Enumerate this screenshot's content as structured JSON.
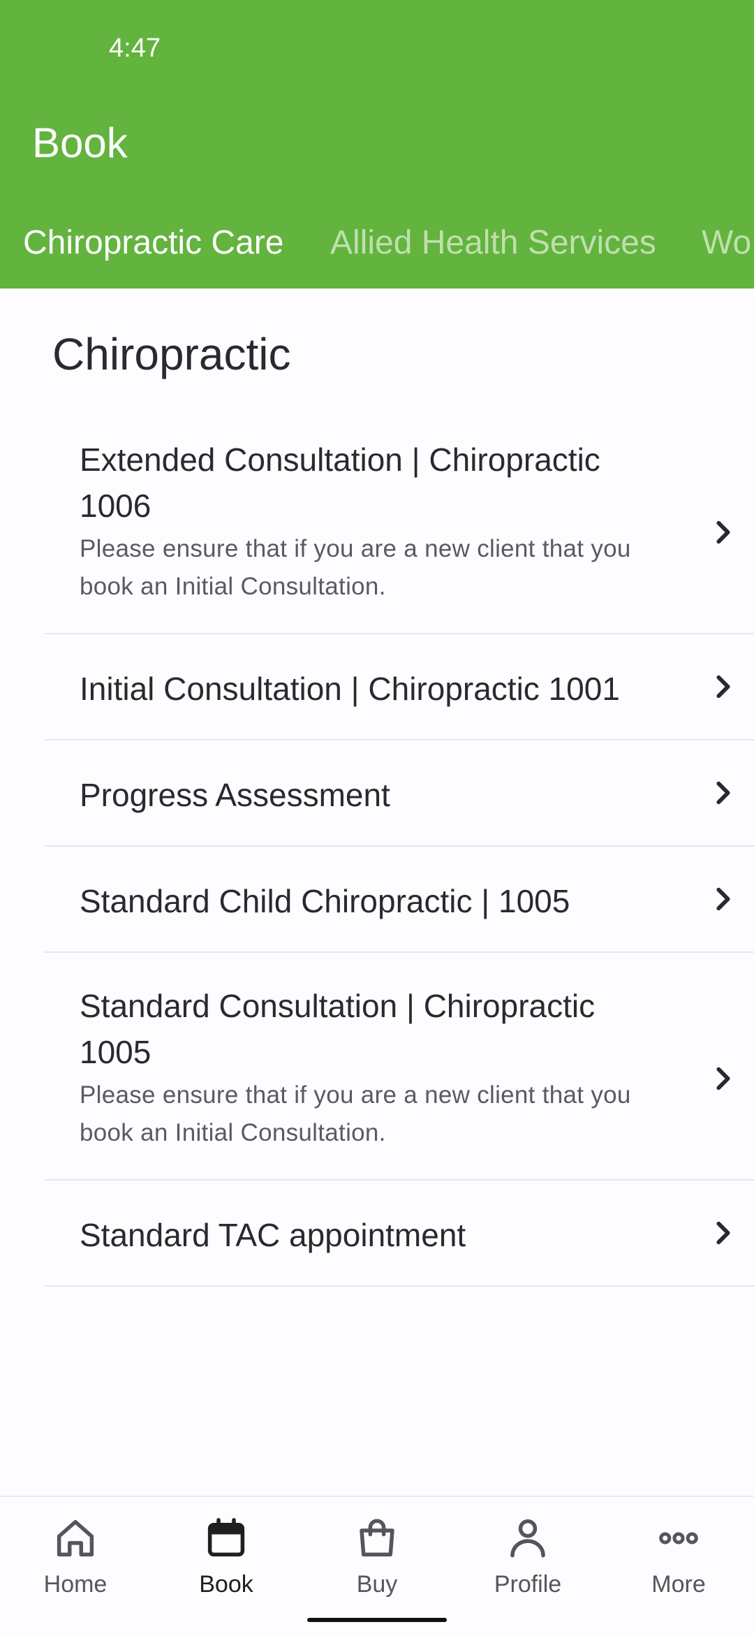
{
  "status_bar": {
    "time": "4:47"
  },
  "header": {
    "title": "Book",
    "background_color": "#63b33f",
    "tabs": [
      {
        "label": "Chiropractic Care",
        "active": true
      },
      {
        "label": "Allied Health Services",
        "active": false
      },
      {
        "label": "Wo",
        "active": false
      }
    ]
  },
  "section": {
    "title": "Chiropractic",
    "items": [
      {
        "title_line1": "Extended Consultation | Chiropractic",
        "title_line2": "1006",
        "desc_line1": "Please ensure that if you are a new client that you",
        "desc_line2": "book an Initial Consultation."
      },
      {
        "title_line1": "Initial Consultation | Chiropractic 1001"
      },
      {
        "title_line1": "Progress Assessment"
      },
      {
        "title_line1": "Standard Child Chiropractic | 1005"
      },
      {
        "title_line1": "Standard Consultation | Chiropractic",
        "title_line2": "1005",
        "desc_line1": "Please ensure that if you are a new client that you",
        "desc_line2": "book an Initial Consultation."
      },
      {
        "title_line1": "Standard TAC appointment"
      }
    ]
  },
  "bottom_nav": {
    "items": [
      {
        "label": "Home",
        "icon": "home-icon",
        "selected": false
      },
      {
        "label": "Book",
        "icon": "calendar-icon",
        "selected": true
      },
      {
        "label": "Buy",
        "icon": "shopping-bag-icon",
        "selected": false
      },
      {
        "label": "Profile",
        "icon": "person-icon",
        "selected": false
      },
      {
        "label": "More",
        "icon": "more-dots-icon",
        "selected": false
      }
    ]
  }
}
